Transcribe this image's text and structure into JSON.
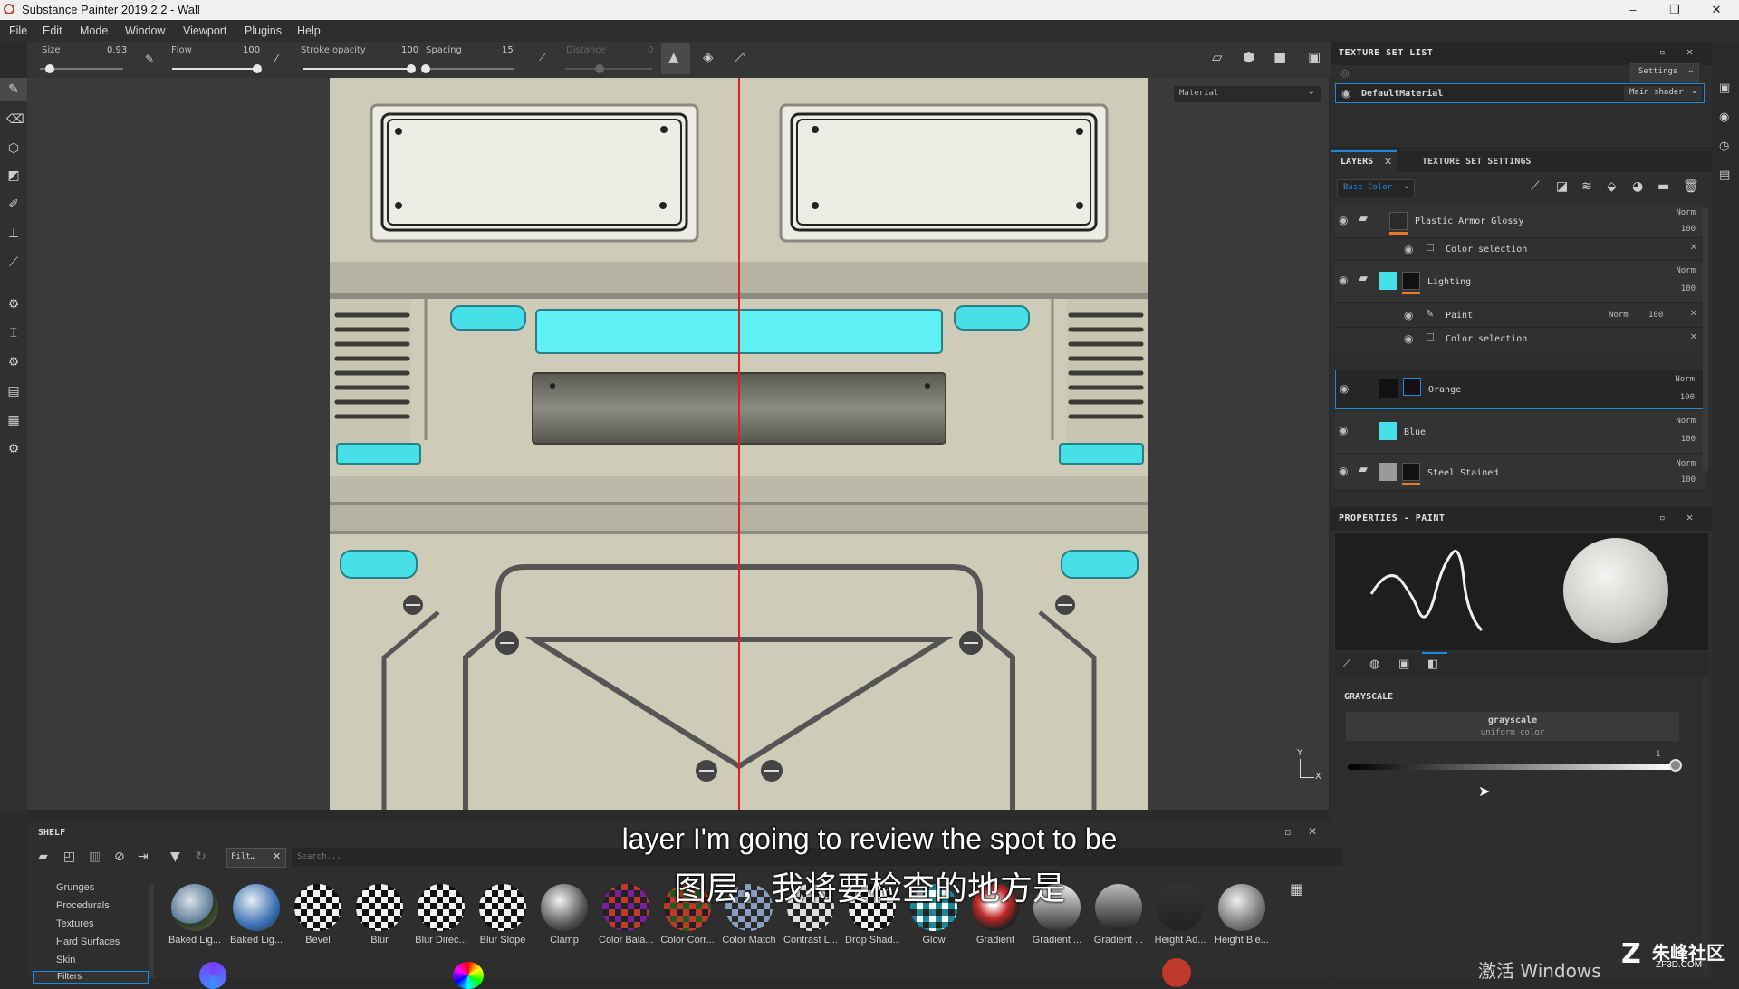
{
  "window": {
    "title": "Substance Painter 2019.2.2 - Wall",
    "minimize": "–",
    "restore": "❐",
    "close": "✕"
  },
  "menu": [
    "File",
    "Edit",
    "Mode",
    "Window",
    "Viewport",
    "Plugins",
    "Help"
  ],
  "tool_options": {
    "size_label": "Size",
    "size_value": "0.93",
    "flow_label": "Flow",
    "flow_value": "100",
    "stroke_opacity_label": "Stroke opacity",
    "stroke_opacity_value": "100",
    "spacing_label": "Spacing",
    "spacing_value": "15",
    "distance_label": "Distance",
    "distance_value": "0"
  },
  "viewport": {
    "material_dropdown": "Material",
    "axis_y": "Y",
    "axis_x": "X"
  },
  "texture_set_list": {
    "title": "TEXTURE SET LIST",
    "settings": "Settings",
    "material": "DefaultMaterial",
    "shader": "Main shader"
  },
  "layers_panel": {
    "tab_layers": "LAYERS",
    "tab_settings": "TEXTURE SET SETTINGS",
    "channel": "Base Color",
    "rows": [
      {
        "name": "Plastic Armor Glossy",
        "blend": "Norm",
        "opacity": "100"
      },
      {
        "name": "Color selection",
        "sub": true
      },
      {
        "name": "Lighting",
        "blend": "Norm",
        "opacity": "100"
      },
      {
        "name": "Paint",
        "blend": "Norm",
        "opacity": "100",
        "sub": true
      },
      {
        "name": "Color selection",
        "sub": true
      },
      {
        "name": "Orange",
        "blend": "Norm",
        "opacity": "100"
      },
      {
        "name": "Blue",
        "blend": "Norm",
        "opacity": "100"
      },
      {
        "name": "Steel Stained",
        "blend": "Norm",
        "opacity": "100"
      }
    ]
  },
  "properties": {
    "title": "PROPERTIES - PAINT",
    "section": "GRAYSCALE",
    "grayscale_title": "grayscale",
    "grayscale_sub": "uniform color",
    "slider_value": "1",
    "slider_fraction": 1.0
  },
  "shelf": {
    "title": "SHELF",
    "filter_chip": "Filt…",
    "search_placeholder": "Search...",
    "categories": [
      "Grunges",
      "Procedurals",
      "Textures",
      "Hard Surfaces",
      "Skin",
      "Filters"
    ],
    "resources": [
      "Baked Lig...",
      "Baked Lig...",
      "Bevel",
      "Blur",
      "Blur Direc...",
      "Blur Slope",
      "Clamp",
      "Color Bala...",
      "Color Corr...",
      "Color Match",
      "Contrast L...",
      "Drop Shad...",
      "Glow",
      "Gradient",
      "Gradient ...",
      "Gradient ...",
      "Height Ad...",
      "Height Ble..."
    ]
  },
  "subtitles": {
    "english": "layer I'm going to review the spot to be",
    "chinese": "图层，我将要检查的地方是"
  },
  "watermark": {
    "activate": "激活 Windows",
    "site_cn": "朱峰社区",
    "site_en": "ZF3D.COM"
  },
  "colors": {
    "accent": "#1e88e5",
    "cyan": "#48e0e8",
    "orange": "#e87a2a"
  }
}
